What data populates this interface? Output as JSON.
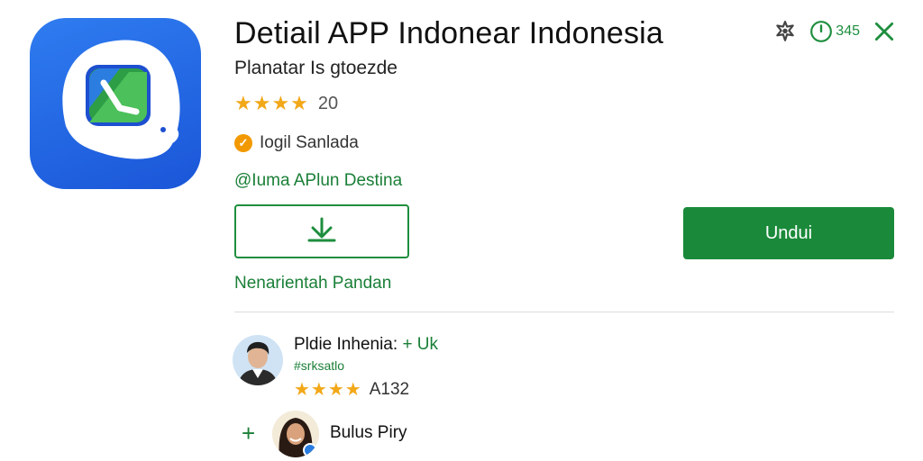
{
  "app": {
    "title": "Detiail APP Indonear Indonesia",
    "subtitle": "Planatar Is gtoezde",
    "rating_stars": "★★★★",
    "rating_count": "20",
    "badge_text": "Iogil Sanlada",
    "developer_link": "@Iuma APlun Destina",
    "secondary_link": "Nenarientah Pandan"
  },
  "top_bar": {
    "count": "345",
    "icons": [
      "settings-icon",
      "clock-icon",
      "close-icon"
    ]
  },
  "buttons": {
    "primary_label": "Undui"
  },
  "reviews": [
    {
      "name": "Pldie Inhenia:",
      "follow_label": "+ Uk",
      "tag": "#srksatlo",
      "stars": "★★★★",
      "count": "A132"
    },
    {
      "add_label": "+",
      "name": "Bulus Piry"
    }
  ],
  "colors": {
    "accent_green": "#1a8a3a",
    "star": "#f2a818",
    "icon_blue": "#1a56d8",
    "badge_orange": "#f29900"
  }
}
